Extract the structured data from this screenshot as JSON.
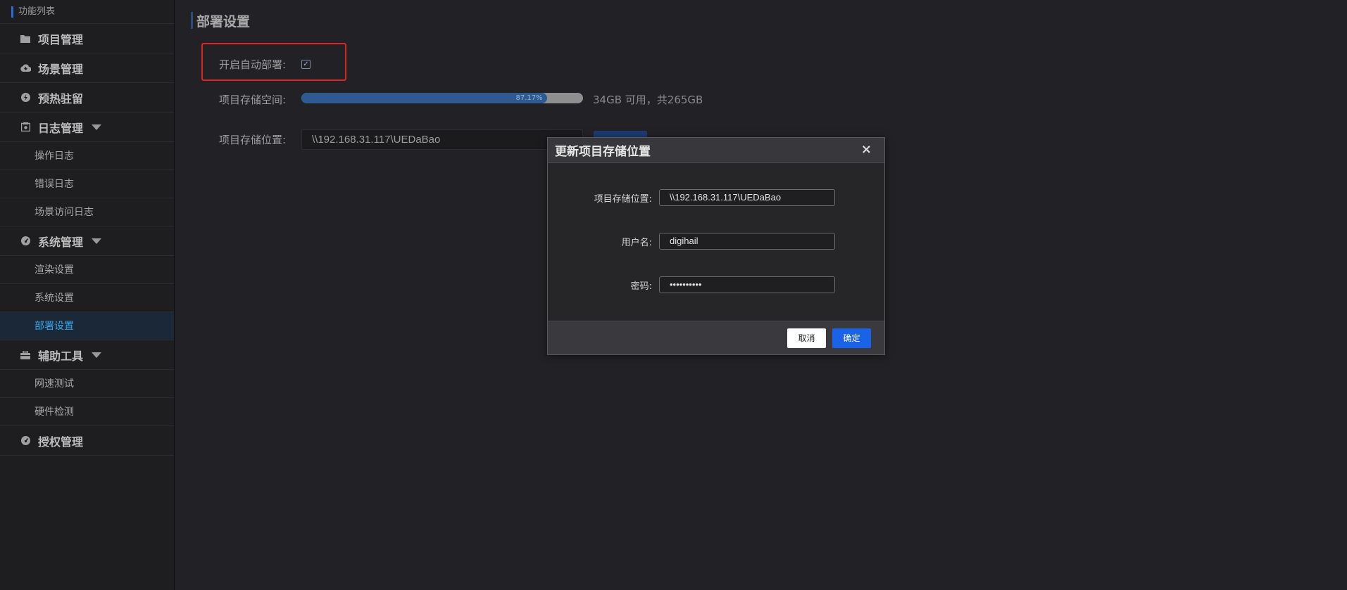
{
  "sidebar": {
    "title": "功能列表",
    "groups": [
      {
        "label": "项目管理",
        "icon": "folder-icon"
      },
      {
        "label": "场景管理",
        "icon": "cloud-icon"
      },
      {
        "label": "预热驻留",
        "icon": "bolt-icon"
      },
      {
        "label": "日志管理",
        "icon": "log-icon"
      },
      {
        "label": "系统管理",
        "icon": "gauge-icon"
      },
      {
        "label": "辅助工具",
        "icon": "toolbox-icon"
      },
      {
        "label": "授权管理",
        "icon": "license-icon"
      }
    ],
    "log_items": [
      "操作日志",
      "错误日志",
      "场景访问日志"
    ],
    "system_items": [
      "渲染设置",
      "系统设置",
      "部署设置"
    ],
    "tool_items": [
      "网速测试",
      "硬件检测"
    ],
    "active_item": "部署设置"
  },
  "main": {
    "page_title": "部署设置",
    "auto_deploy_label": "开启自动部署:",
    "auto_deploy_checked": true,
    "checkbox_glyph": "✓",
    "storage_space_label": "项目存储空间:",
    "storage_percent_value": 87.17,
    "storage_percent": "87.17%",
    "storage_text": "34GB 可用，共265GB",
    "storage_location_label": "项目存储位置:",
    "storage_location_value": "\\\\192.168.31.117\\UEDaBao"
  },
  "modal": {
    "title": "更新项目存储位置",
    "close_glyph": "×",
    "location_label": "项目存储位置:",
    "location_value": "\\\\192.168.31.117\\UEDaBao",
    "username_label": "用户名:",
    "username_value": "digihail",
    "password_label": "密码:",
    "password_value": "••••••••••",
    "cancel_label": "取消",
    "ok_label": "确定"
  },
  "colors": {
    "accent_blue": "#1a63e8",
    "active_text": "#3aa6e8",
    "highlight_red": "#e02424",
    "progress_fill": "#2f5a91"
  }
}
